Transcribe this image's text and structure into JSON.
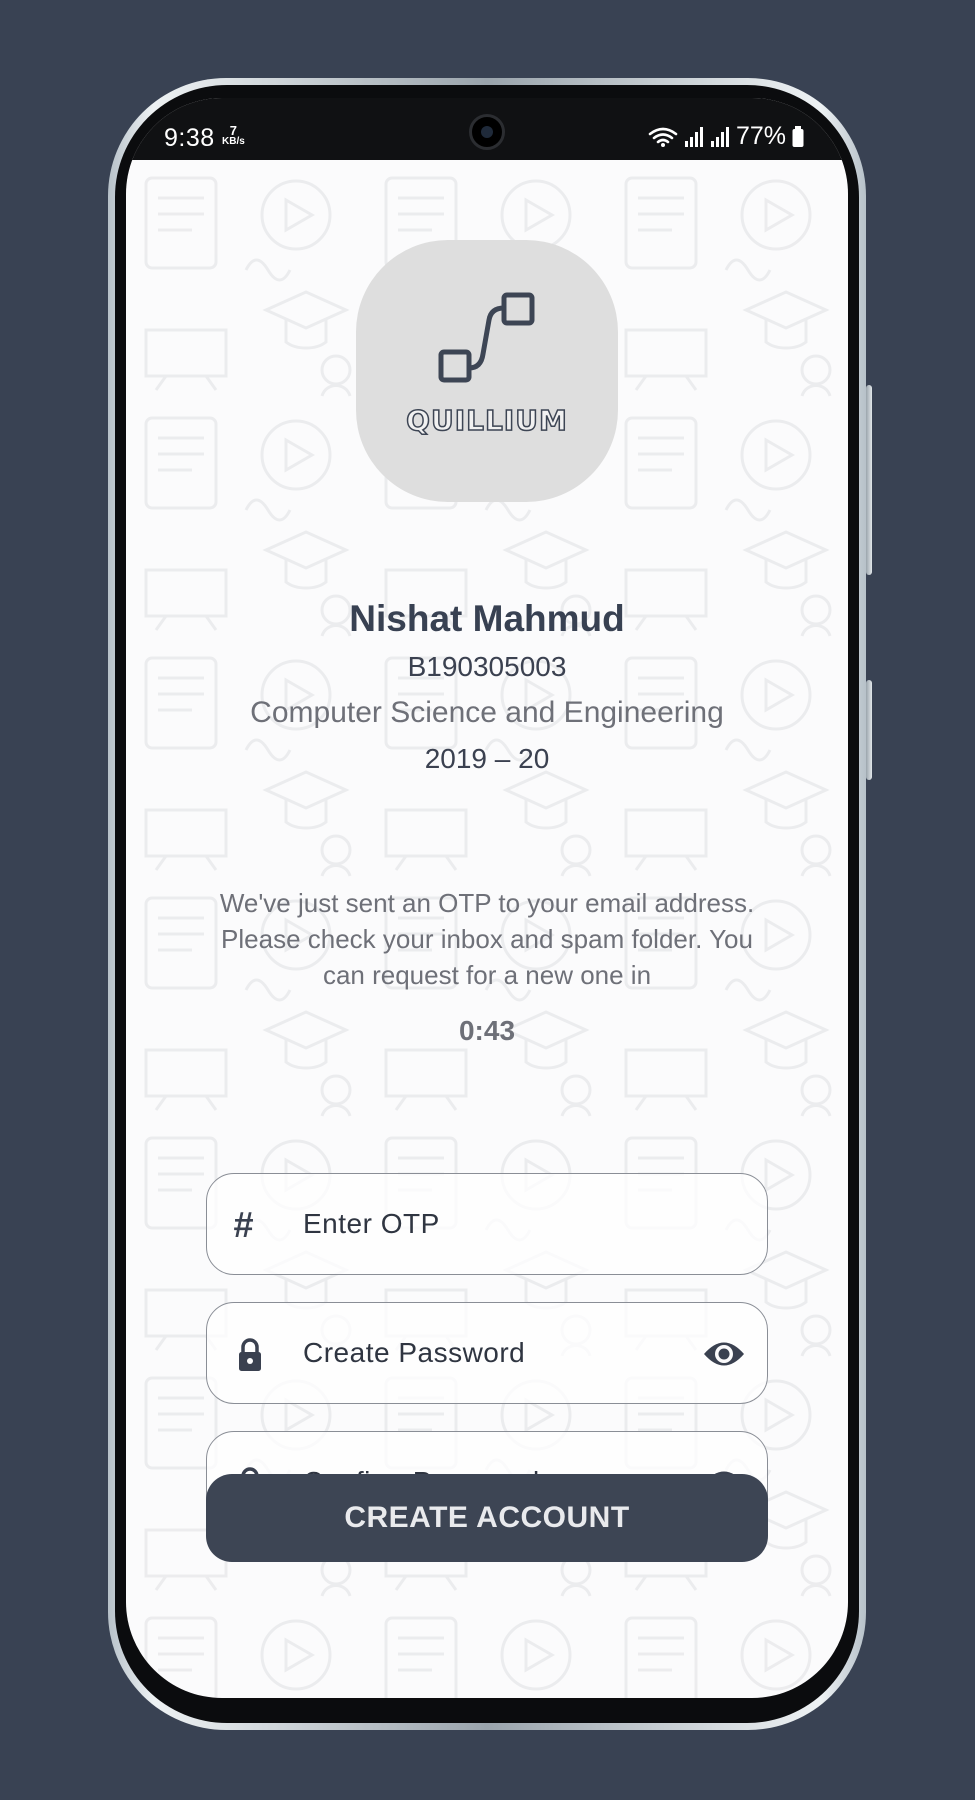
{
  "status_bar": {
    "time": "9:38",
    "net_speed_value": "7",
    "net_speed_unit": "KB/s",
    "battery": "77%"
  },
  "logo": {
    "text": "QUILLIUM"
  },
  "profile": {
    "name": "Nishat Mahmud",
    "student_id": "B190305003",
    "department": "Computer Science and Engineering",
    "session": "2019 – 20"
  },
  "otp": {
    "message": "We've just sent an OTP to your email address. Please check your inbox and spam folder. You can request for a new one in",
    "countdown": "0:43"
  },
  "form": {
    "otp_placeholder": "Enter OTP",
    "password_placeholder": "Create Password",
    "confirm_placeholder": "Confirm Password",
    "submit_label": "CREATE ACCOUNT"
  },
  "icons": {
    "otp": "hash-icon",
    "password": "lock-icon",
    "visibility": "eye-icon"
  },
  "colors": {
    "background": "#394253",
    "primary": "#3d4554",
    "text_muted": "#6e7078"
  }
}
